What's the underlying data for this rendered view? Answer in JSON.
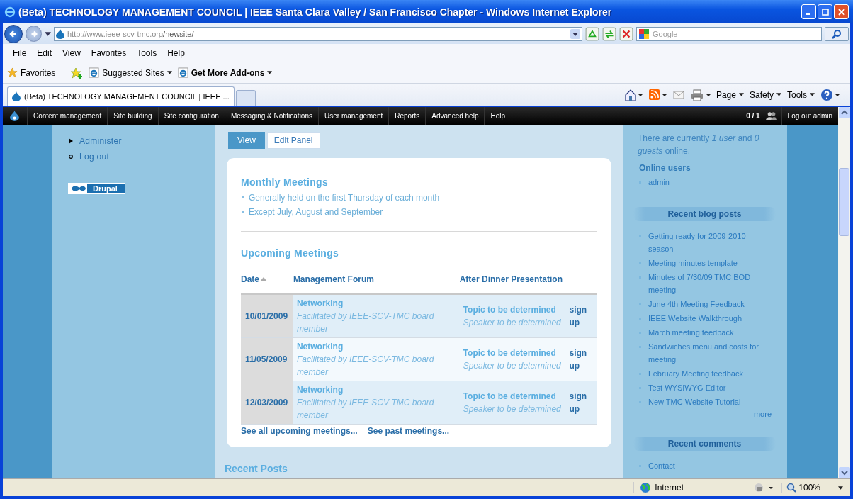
{
  "window": {
    "title": "(Beta) TECHNOLOGY MANAGEMENT COUNCIL | IEEE Santa Clara Valley / San Francisco Chapter - Windows Internet Explorer"
  },
  "address": {
    "url_host": "http://www.ieee-scv-tmc.org",
    "url_path": "/newsite/"
  },
  "search": {
    "placeholder": "Google"
  },
  "menu": [
    "File",
    "Edit",
    "View",
    "Favorites",
    "Tools",
    "Help"
  ],
  "favorites_bar": {
    "favorites": "Favorites",
    "links": [
      {
        "label": "Suggested Sites",
        "bold": false
      },
      {
        "label": "Get More Add-ons",
        "bold": true
      }
    ]
  },
  "tabs": [
    {
      "label": "(Beta) TECHNOLOGY MANAGEMENT COUNCIL | IEEE ...",
      "selected": true
    }
  ],
  "command_bar": [
    "Page",
    "Safety",
    "Tools"
  ],
  "admin_bar": {
    "items": [
      "Content management",
      "Site building",
      "Site configuration",
      "Messaging & Notifications",
      "User management",
      "Reports",
      "Advanced help",
      "Help"
    ],
    "counter": "0 / 1",
    "logout": "Log out admin"
  },
  "left_sidebar": {
    "items": [
      {
        "label": "Administer",
        "kind": "collapsed"
      },
      {
        "label": "Log out",
        "kind": "leaf"
      }
    ],
    "badge": "Drupal"
  },
  "main": {
    "view_tabs": [
      {
        "label": "View",
        "selected": true
      },
      {
        "label": "Edit Panel",
        "selected": false
      }
    ],
    "monthly": {
      "heading": "Monthly Meetings",
      "bullets": [
        "Generally held on the first Thursday of each month",
        "Except July, August and September"
      ]
    },
    "upcoming": {
      "heading": "Upcoming Meetings",
      "columns": [
        {
          "label": "Date",
          "sorted": true
        },
        {
          "label": "Management Forum",
          "sorted": false
        },
        {
          "label": "After Dinner Presentation",
          "sorted": false
        }
      ],
      "rows": [
        {
          "date": "10/01/2009",
          "forum": "Networking",
          "facilitator": "Facilitated by IEEE-SCV-TMC board member",
          "topic": "Topic to be determined",
          "speaker": "Speaker to be determined",
          "action": "sign up"
        },
        {
          "date": "11/05/2009",
          "forum": "Networking",
          "facilitator": "Facilitated by IEEE-SCV-TMC board member",
          "topic": "Topic to be determined",
          "speaker": "Speaker to be determined",
          "action": "sign up"
        },
        {
          "date": "12/03/2009",
          "forum": "Networking",
          "facilitator": "Facilitated by IEEE-SCV-TMC board member",
          "topic": "Topic to be determined",
          "speaker": "Speaker to be determined",
          "action": "sign up"
        }
      ],
      "links": [
        "See all upcoming meetings...",
        "See past meetings..."
      ]
    },
    "recent_posts_heading": "Recent Posts"
  },
  "right_sidebar": {
    "online_text": "There are currently *1 user* and *0 guests* online.",
    "online_heading": "Online users",
    "online_users": [
      "admin"
    ],
    "blog_heading": "Recent blog posts",
    "blog_posts": [
      "Getting ready for 2009-2010 season",
      "Meeting minutes template",
      "Minutes of 7/30/09 TMC BOD meeting",
      "June 4th Meeting Feedback",
      "IEEE Website Walkthrough",
      "March meeting feedback",
      "Sandwiches menu and costs for meeting",
      "February Meeting feedback",
      "Test WYSIWYG Editor",
      "New TMC Website Tutorial"
    ],
    "more": "more",
    "comments_heading": "Recent comments",
    "comments": [
      "Contact"
    ]
  },
  "status_bar": {
    "zone": "Internet",
    "zoom": "100%"
  }
}
